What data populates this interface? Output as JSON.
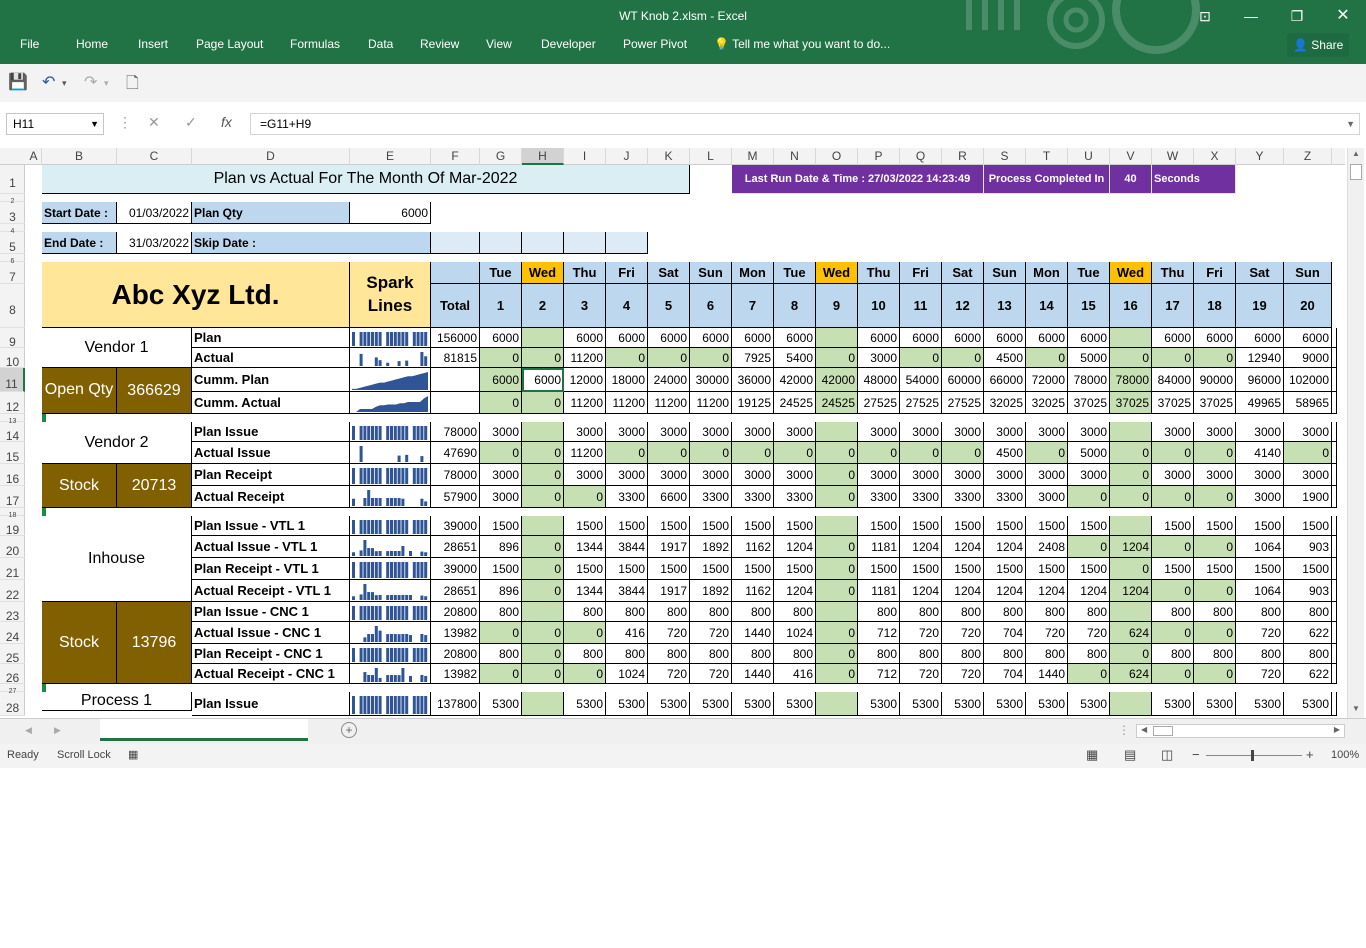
{
  "window": {
    "title": "WT Knob 2.xlsm - Excel",
    "share_label": "Share"
  },
  "ribbon_tabs": [
    "File",
    "Home",
    "Insert",
    "Page Layout",
    "Formulas",
    "Data",
    "Review",
    "View",
    "Developer",
    "Power Pivot"
  ],
  "tell_me": "Tell me what you want to do...",
  "formula_bar": {
    "name_box": "H11",
    "formula": "=G11+H9"
  },
  "columns": [
    "A",
    "B",
    "C",
    "D",
    "E",
    "F",
    "G",
    "H",
    "I",
    "J",
    "K",
    "L",
    "M",
    "N",
    "O",
    "P",
    "Q",
    "R",
    "S",
    "T",
    "U",
    "V",
    "W",
    "X",
    "Y",
    "Z"
  ],
  "rows": [
    "1",
    "2",
    "3",
    "4",
    "5",
    "6",
    "7",
    "8",
    "9",
    "10",
    "11",
    "12",
    "13",
    "14",
    "15",
    "16",
    "17",
    "18",
    "19",
    "20",
    "21",
    "22",
    "23",
    "24",
    "25",
    "26",
    "27",
    "28"
  ],
  "sheet": {
    "title": "Plan vs Actual For The Month Of Mar-2022",
    "last_run": "Last Run Date & Time : 27/03/2022 14:23:49",
    "process_completed": "Process Completed In",
    "process_seconds_value": "40",
    "seconds_label": "Seconds",
    "start_date_label": "Start Date :",
    "start_date": "01/03/2022",
    "plan_qty_label": "Plan Qty",
    "plan_qty": "6000",
    "end_date_label": "End Date :",
    "end_date": "31/03/2022",
    "skip_date_label": "Skip Date :",
    "company": "Abc Xyz Ltd.",
    "spark_lines": "Spark Lines",
    "total_label": "Total",
    "days": [
      "Tue",
      "Wed",
      "Thu",
      "Fri",
      "Sat",
      "Sun",
      "Mon",
      "Tue",
      "Wed",
      "Thu",
      "Fri",
      "Sat",
      "Sun",
      "Mon",
      "Tue",
      "Wed",
      "Thu",
      "Fri",
      "Sat",
      "Sun"
    ],
    "dates": [
      "1",
      "2",
      "3",
      "4",
      "5",
      "6",
      "7",
      "8",
      "9",
      "10",
      "11",
      "12",
      "13",
      "14",
      "15",
      "16",
      "17",
      "18",
      "19",
      "20"
    ],
    "vendor1": "Vendor 1",
    "open_qty": "Open Qty",
    "open_qty_value": "366629",
    "vendor2": "Vendor 2",
    "stock": "Stock",
    "stock1_value": "20713",
    "inhouse": "Inhouse",
    "stock2_value": "13796",
    "process1": "Process 1",
    "data_rows": [
      {
        "row": "9",
        "label": "Plan",
        "total": "156000",
        "vals": [
          "6000",
          "",
          "6000",
          "6000",
          "6000",
          "6000",
          "6000",
          "6000",
          "",
          "6000",
          "6000",
          "6000",
          "6000",
          "6000",
          "6000",
          "",
          "6000",
          "6000",
          "6000",
          "6000"
        ]
      },
      {
        "row": "10",
        "label": "Actual",
        "total": "81815",
        "vals": [
          "0",
          "0",
          "11200",
          "0",
          "0",
          "0",
          "7925",
          "5400",
          "0",
          "3000",
          "0",
          "0",
          "4500",
          "0",
          "5000",
          "0",
          "0",
          "0",
          "12940",
          "9000"
        ]
      },
      {
        "row": "11",
        "label": "Cumm. Plan",
        "total": "",
        "vals": [
          "6000",
          "6000",
          "12000",
          "18000",
          "24000",
          "30000",
          "36000",
          "42000",
          "42000",
          "48000",
          "54000",
          "60000",
          "66000",
          "72000",
          "78000",
          "78000",
          "84000",
          "90000",
          "96000",
          "102000"
        ]
      },
      {
        "row": "12",
        "label": "Cumm. Actual",
        "total": "",
        "vals": [
          "0",
          "0",
          "11200",
          "11200",
          "11200",
          "11200",
          "19125",
          "24525",
          "24525",
          "27525",
          "27525",
          "27525",
          "32025",
          "32025",
          "37025",
          "37025",
          "37025",
          "37025",
          "49965",
          "58965"
        ]
      },
      {
        "row": "14",
        "label": "Plan Issue",
        "total": "78000",
        "vals": [
          "3000",
          "",
          "3000",
          "3000",
          "3000",
          "3000",
          "3000",
          "3000",
          "",
          "3000",
          "3000",
          "3000",
          "3000",
          "3000",
          "3000",
          "",
          "3000",
          "3000",
          "3000",
          "3000"
        ]
      },
      {
        "row": "15",
        "label": "Actual Issue",
        "total": "47690",
        "vals": [
          "0",
          "0",
          "11200",
          "0",
          "0",
          "0",
          "0",
          "0",
          "0",
          "0",
          "0",
          "0",
          "4500",
          "0",
          "5000",
          "0",
          "0",
          "0",
          "4140",
          "0"
        ]
      },
      {
        "row": "16",
        "label": "Plan Receipt",
        "total": "78000",
        "vals": [
          "3000",
          "0",
          "3000",
          "3000",
          "3000",
          "3000",
          "3000",
          "3000",
          "0",
          "3000",
          "3000",
          "3000",
          "3000",
          "3000",
          "3000",
          "0",
          "3000",
          "3000",
          "3000",
          "3000"
        ]
      },
      {
        "row": "17",
        "label": "Actual Receipt",
        "total": "57900",
        "vals": [
          "3000",
          "0",
          "0",
          "3300",
          "6600",
          "3300",
          "3300",
          "3300",
          "0",
          "3300",
          "3300",
          "3300",
          "3300",
          "3000",
          "0",
          "0",
          "0",
          "0",
          "3000",
          "1900"
        ]
      },
      {
        "row": "19",
        "label": "Plan Issue - VTL 1",
        "total": "39000",
        "vals": [
          "1500",
          "",
          "1500",
          "1500",
          "1500",
          "1500",
          "1500",
          "1500",
          "",
          "1500",
          "1500",
          "1500",
          "1500",
          "1500",
          "1500",
          "",
          "1500",
          "1500",
          "1500",
          "1500"
        ]
      },
      {
        "row": "20",
        "label": "Actual Issue - VTL 1",
        "total": "28651",
        "vals": [
          "896",
          "0",
          "1344",
          "3844",
          "1917",
          "1892",
          "1162",
          "1204",
          "0",
          "1181",
          "1204",
          "1204",
          "1204",
          "2408",
          "0",
          "1204",
          "0",
          "0",
          "1064",
          "903"
        ]
      },
      {
        "row": "21",
        "label": "Plan Receipt - VTL 1",
        "total": "39000",
        "vals": [
          "1500",
          "0",
          "1500",
          "1500",
          "1500",
          "1500",
          "1500",
          "1500",
          "0",
          "1500",
          "1500",
          "1500",
          "1500",
          "1500",
          "1500",
          "0",
          "1500",
          "1500",
          "1500",
          "1500"
        ]
      },
      {
        "row": "22",
        "label": "Actual Receipt - VTL 1",
        "total": "28651",
        "vals": [
          "896",
          "0",
          "1344",
          "3844",
          "1917",
          "1892",
          "1162",
          "1204",
          "0",
          "1181",
          "1204",
          "1204",
          "1204",
          "1204",
          "1204",
          "1204",
          "0",
          "0",
          "1064",
          "903"
        ]
      },
      {
        "row": "23",
        "label": "Plan Issue - CNC 1",
        "total": "20800",
        "vals": [
          "800",
          "",
          "800",
          "800",
          "800",
          "800",
          "800",
          "800",
          "",
          "800",
          "800",
          "800",
          "800",
          "800",
          "800",
          "",
          "800",
          "800",
          "800",
          "800"
        ]
      },
      {
        "row": "24",
        "label": "Actual Issue - CNC 1",
        "total": "13982",
        "vals": [
          "0",
          "0",
          "0",
          "416",
          "720",
          "720",
          "1440",
          "1024",
          "0",
          "712",
          "720",
          "720",
          "704",
          "720",
          "720",
          "624",
          "0",
          "0",
          "720",
          "622"
        ]
      },
      {
        "row": "25",
        "label": "Plan Receipt - CNC 1",
        "total": "20800",
        "vals": [
          "800",
          "0",
          "800",
          "800",
          "800",
          "800",
          "800",
          "800",
          "0",
          "800",
          "800",
          "800",
          "800",
          "800",
          "800",
          "0",
          "800",
          "800",
          "800",
          "800"
        ]
      },
      {
        "row": "26",
        "label": "Actual Receipt - CNC 1",
        "total": "13982",
        "vals": [
          "0",
          "0",
          "0",
          "1024",
          "720",
          "720",
          "1440",
          "416",
          "0",
          "712",
          "720",
          "720",
          "704",
          "1440",
          "0",
          "624",
          "0",
          "0",
          "720",
          "622"
        ]
      },
      {
        "row": "28",
        "label": "Plan Issue",
        "total": "137800",
        "vals": [
          "5300",
          "",
          "5300",
          "5300",
          "5300",
          "5300",
          "5300",
          "5300",
          "",
          "5300",
          "5300",
          "5300",
          "5300",
          "5300",
          "5300",
          "",
          "5300",
          "5300",
          "5300",
          "5300"
        ]
      }
    ]
  },
  "status_bar": {
    "ready": "Ready",
    "scroll_lock": "Scroll Lock",
    "zoom": "100%"
  },
  "colors": {
    "excel_green": "#217346",
    "purple": "#7030a0",
    "olive": "#806000",
    "yellow": "#ffe699",
    "blue": "#bdd7ee",
    "green_fill": "#c6e0b4",
    "divider": "#1e8a3e"
  }
}
